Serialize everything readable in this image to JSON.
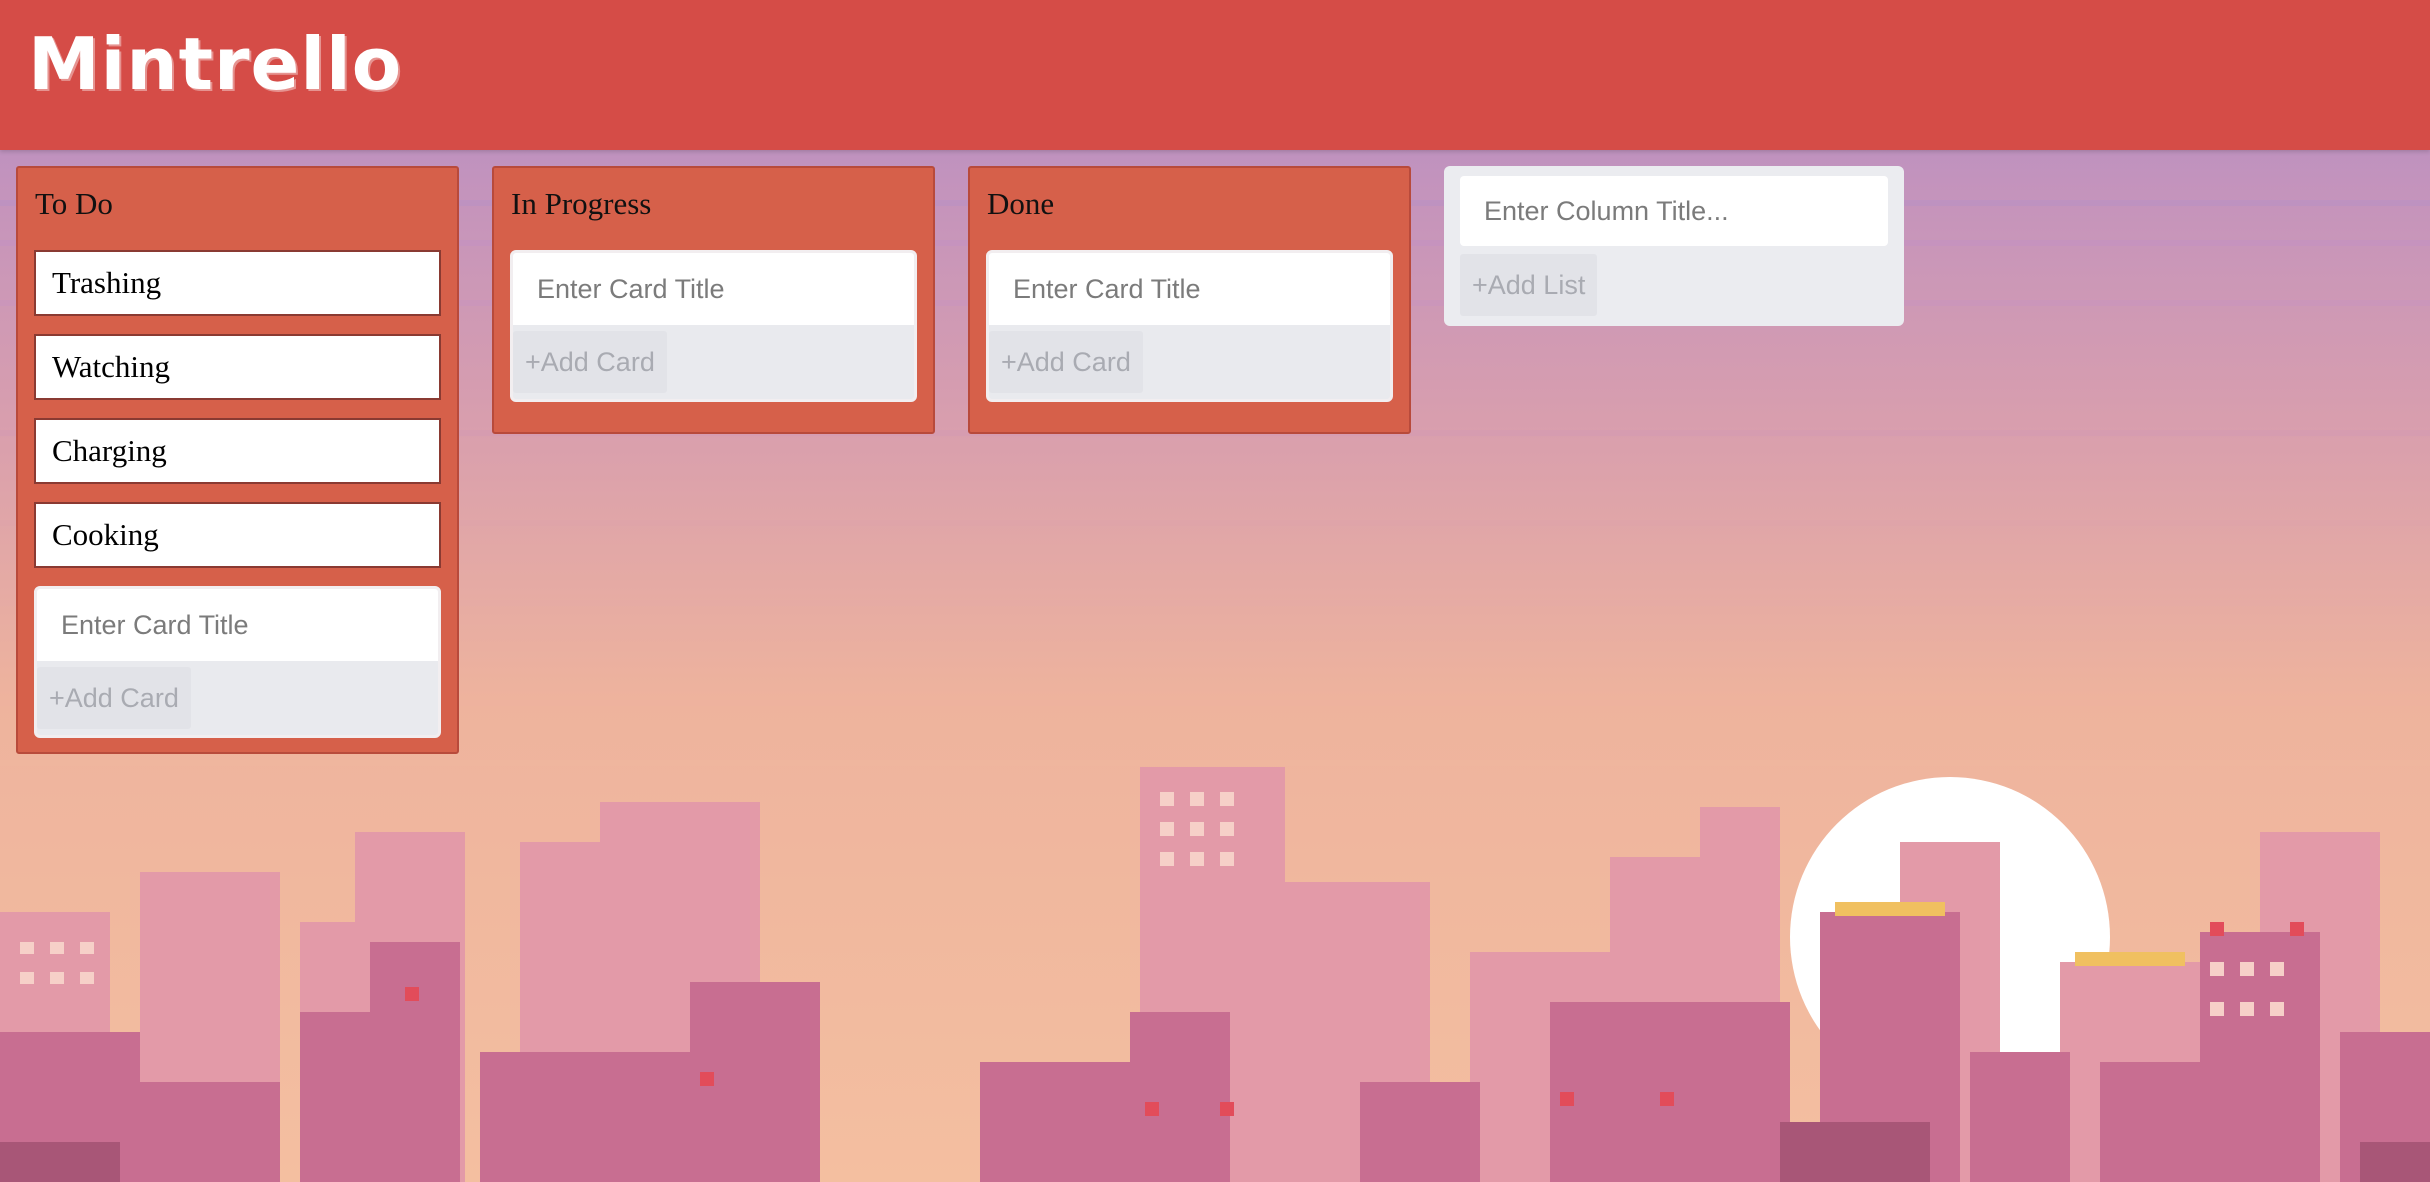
{
  "app": {
    "title": "Mintrello"
  },
  "theme": {
    "header_color": "#d54c47",
    "column_color": "#d6604a"
  },
  "columns": [
    {
      "title": "To Do",
      "cards": [
        "Trashing",
        "Watching",
        "Charging",
        "Cooking"
      ],
      "card_input_placeholder": "Enter Card Title",
      "add_card_label": "+Add Card"
    },
    {
      "title": "In Progress",
      "cards": [],
      "card_input_placeholder": "Enter Card Title",
      "add_card_label": "+Add Card"
    },
    {
      "title": "Done",
      "cards": [],
      "card_input_placeholder": "Enter Card Title",
      "add_card_label": "+Add Card"
    }
  ],
  "new_list": {
    "placeholder": "Enter Column Title...",
    "add_list_label": "+Add List"
  }
}
